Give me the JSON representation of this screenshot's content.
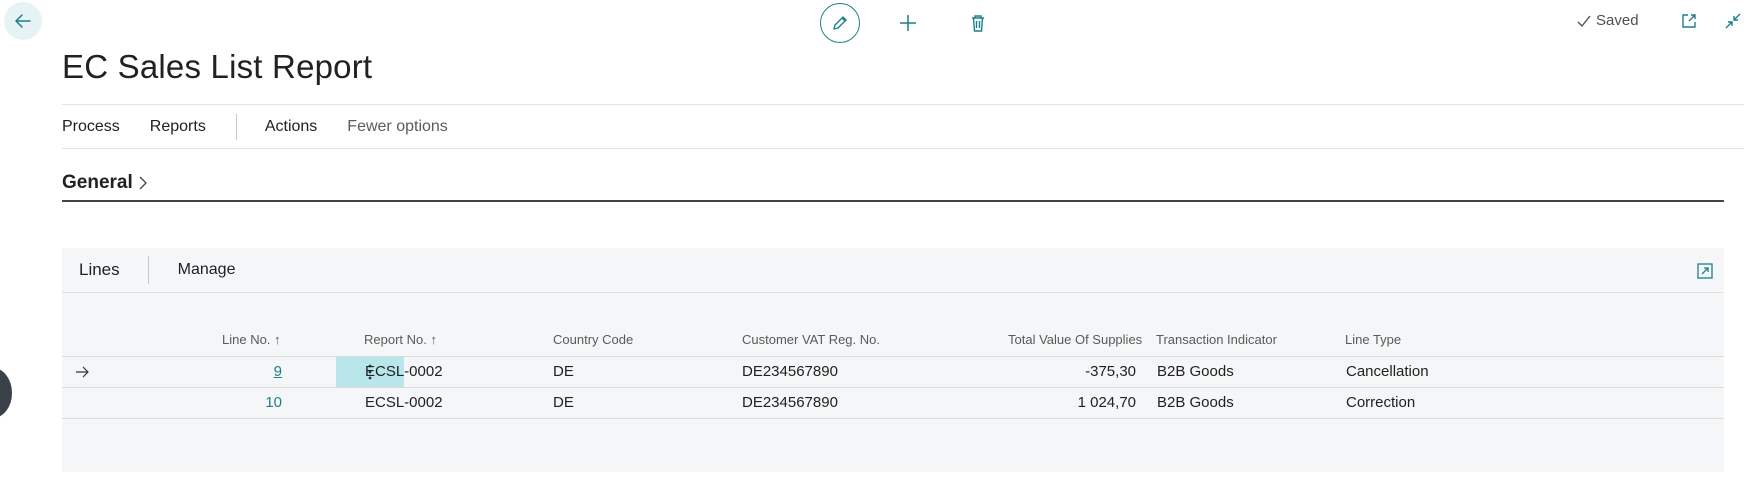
{
  "header": {
    "title": "EC Sales List Report",
    "saved_label": "Saved"
  },
  "action_bar": {
    "items": [
      "Process",
      "Reports",
      "Actions",
      "Fewer options"
    ]
  },
  "general": {
    "label": "General"
  },
  "lines": {
    "title": "Lines",
    "manage_label": "Manage",
    "columns": {
      "line_no": "Line No.",
      "report_no": "Report No.",
      "country_code": "Country Code",
      "customer_vat": "Customer VAT Reg. No.",
      "total_value": "Total Value Of Supplies",
      "transaction_indicator": "Transaction Indicator",
      "line_type": "Line Type"
    },
    "rows": [
      {
        "line_no": "9",
        "report_no": "ECSL-0002",
        "country_code": "DE",
        "customer_vat": "DE234567890",
        "total_value": "-375,30",
        "transaction_indicator": "B2B Goods",
        "line_type": "Cancellation"
      },
      {
        "line_no": "10",
        "report_no": "ECSL-0002",
        "country_code": "DE",
        "customer_vat": "DE234567890",
        "total_value": "1 024,70",
        "transaction_indicator": "B2B Goods",
        "line_type": "Correction"
      }
    ]
  },
  "colors": {
    "accent": "#1d7f8a",
    "selected_cell": "#b9e6ea"
  }
}
